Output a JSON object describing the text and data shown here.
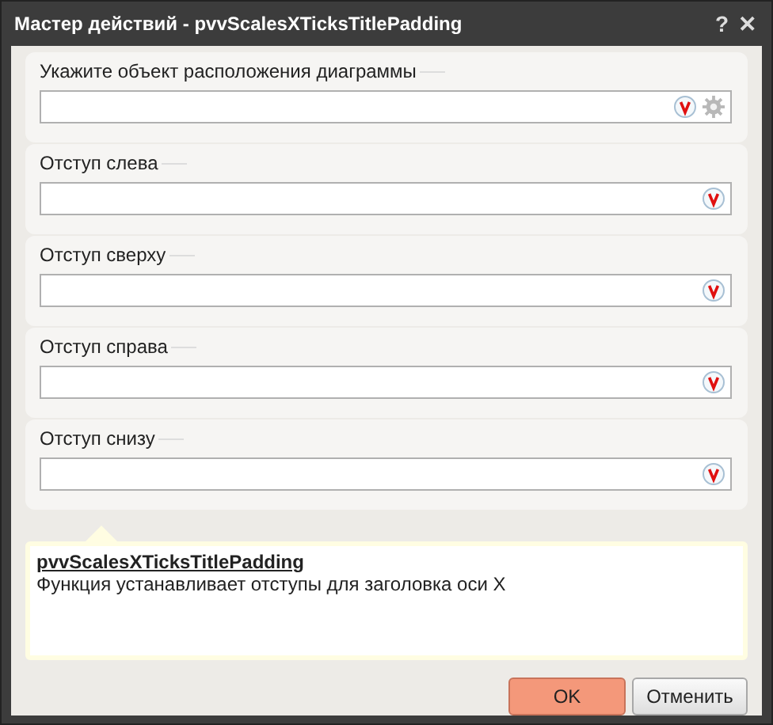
{
  "window": {
    "title": "Мастер действий - pvvScalesXTicksTitlePadding",
    "help": "?",
    "close": "✕"
  },
  "fields": [
    {
      "label": "Укажите объект расположения диаграммы",
      "kind": "object"
    },
    {
      "label": "Отступ слева",
      "kind": "plain"
    },
    {
      "label": "Отступ сверху",
      "kind": "plain"
    },
    {
      "label": "Отступ справа",
      "kind": "plain"
    },
    {
      "label": "Отступ снизу",
      "kind": "plain"
    }
  ],
  "description": {
    "title": "pvvScalesXTicksTitlePadding",
    "text": "Функция устанавливает отступы для заголовка оси X"
  },
  "buttons": [
    {
      "label": "OK",
      "kind": "primary"
    },
    {
      "label": "Отменить",
      "kind": "secondary"
    }
  ]
}
